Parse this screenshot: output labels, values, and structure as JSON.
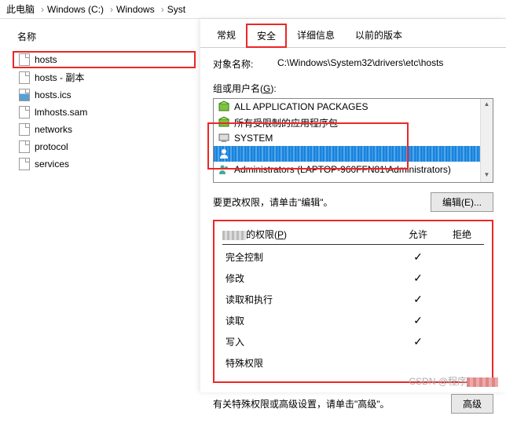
{
  "breadcrumb": [
    "此电脑",
    "Windows (C:)",
    "Windows",
    "Syst"
  ],
  "left": {
    "name_header": "名称",
    "files": [
      {
        "name": "hosts",
        "highlighted": true,
        "icon": "doc"
      },
      {
        "name": "hosts - 副本",
        "highlighted": false,
        "icon": "doc"
      },
      {
        "name": "hosts.ics",
        "highlighted": false,
        "icon": "ini"
      },
      {
        "name": "lmhosts.sam",
        "highlighted": false,
        "icon": "doc"
      },
      {
        "name": "networks",
        "highlighted": false,
        "icon": "doc"
      },
      {
        "name": "protocol",
        "highlighted": false,
        "icon": "doc"
      },
      {
        "name": "services",
        "highlighted": false,
        "icon": "doc"
      }
    ]
  },
  "tabs": {
    "items": [
      {
        "label": "常规",
        "active": false,
        "highlighted": false
      },
      {
        "label": "安全",
        "active": true,
        "highlighted": true
      },
      {
        "label": "详细信息",
        "active": false,
        "highlighted": false
      },
      {
        "label": "以前的版本",
        "active": false,
        "highlighted": false
      }
    ]
  },
  "obj": {
    "label": "对象名称:",
    "value": "C:\\Windows\\System32\\drivers\\etc\\hosts"
  },
  "groups": {
    "label_prefix": "组或用户名(",
    "label_key": "G",
    "label_suffix": "):",
    "items": [
      {
        "type": "pkg",
        "label": "ALL APPLICATION PACKAGES"
      },
      {
        "type": "pkg",
        "label": "所有受限制的应用程序包"
      },
      {
        "type": "sys",
        "label": "SYSTEM"
      },
      {
        "type": "user",
        "label": "",
        "selected": true,
        "pixelated": true
      },
      {
        "type": "users",
        "label": "Administrators (LAPTOP-960FFN81\\Administrators)"
      }
    ]
  },
  "edit": {
    "text": "要更改权限，请单击\"编辑\"。",
    "button": "编辑(E)..."
  },
  "perms": {
    "title_suffix": "的权限(",
    "title_key": "P",
    "title_end": ")",
    "allow": "允许",
    "deny": "拒绝",
    "rows": [
      {
        "name": "完全控制",
        "allow": true
      },
      {
        "name": "修改",
        "allow": true
      },
      {
        "name": "读取和执行",
        "allow": true
      },
      {
        "name": "读取",
        "allow": true
      },
      {
        "name": "写入",
        "allow": true
      },
      {
        "name": "特殊权限",
        "allow": false
      }
    ]
  },
  "adv": {
    "text": "有关特殊权限或高级设置，请单击\"高级\"。",
    "button": "高级"
  },
  "watermark": {
    "prefix": "CSDN @程序"
  }
}
